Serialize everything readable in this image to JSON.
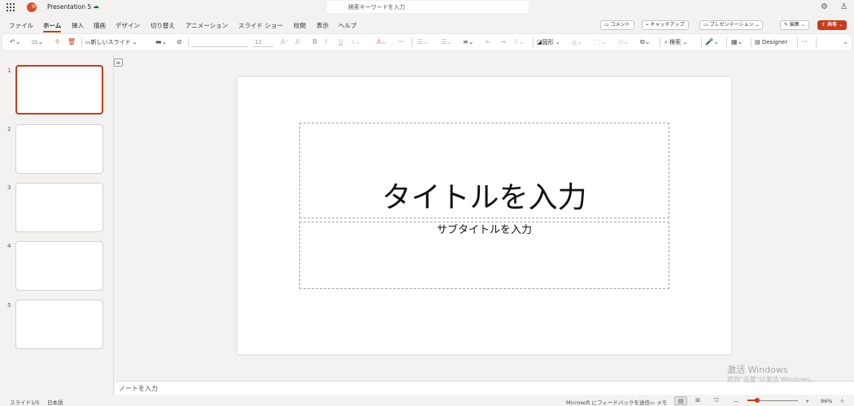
{
  "app": {
    "doc_title": "Presentation 5",
    "search_placeholder": "検索キーワードを入力"
  },
  "menu": {
    "tabs": [
      "ファイル",
      "ホーム",
      "挿入",
      "描画",
      "デザイン",
      "切り替え",
      "アニメーション",
      "スライド ショー",
      "校閲",
      "表示",
      "ヘルプ"
    ],
    "active_tab": "ホーム"
  },
  "header_buttons": {
    "comment": "コメント",
    "catchup": "キャッチアップ",
    "present": "プレゼンテーション",
    "edit": "編集",
    "share": "共有"
  },
  "ribbon": {
    "new_slide": "新しいスライド",
    "font_size": "12",
    "shapes": "図形",
    "search": "検索",
    "designer": "Designer"
  },
  "slides": {
    "numbers": [
      "1",
      "2",
      "3",
      "4",
      "5"
    ],
    "selected_index": 1
  },
  "canvas": {
    "title_placeholder": "タイトルを入力",
    "subtitle_placeholder": "サブタイトルを入力"
  },
  "notes": {
    "placeholder": "ノートを入力"
  },
  "watermark": {
    "line1": "激活 Windows",
    "line2": "转到\"设置\"以激活 Windows。"
  },
  "status": {
    "slide_counter": "スライド1/5",
    "language": "日本語",
    "feedback": "Microsoft にフィードバックを送信",
    "notes_label": "メモ",
    "zoom": "86%"
  },
  "colors": {
    "accent": "#c43e1c"
  }
}
